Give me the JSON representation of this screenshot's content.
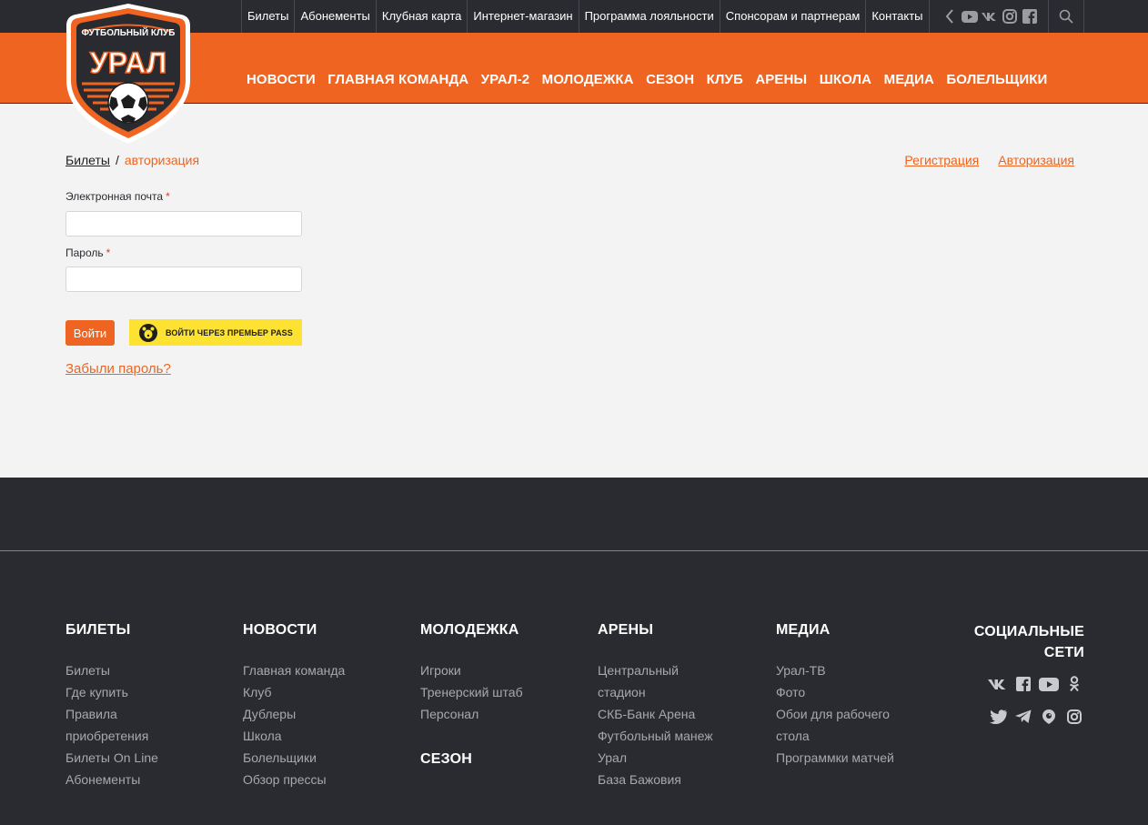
{
  "brand": {
    "logo_top_text": "ФУТБОЛЬНЫЙ КЛУБ",
    "logo_name": "УРАЛ"
  },
  "topnav": {
    "items": [
      "Билеты",
      "Абонементы",
      "Клубная карта",
      "Интернет-магазин",
      "Программа лояльности",
      "Спонсорам и партнерам",
      "Контакты"
    ],
    "icons": [
      "chevron-left-icon",
      "youtube-icon",
      "vk-icon",
      "instagram-icon",
      "facebook-icon"
    ],
    "search_icon": "search-icon"
  },
  "mainnav": {
    "items": [
      "НОВОСТИ",
      "ГЛАВНАЯ КОМАНДА",
      "УРАЛ-2",
      "МОЛОДЕЖКА",
      "СЕЗОН",
      "КЛУБ",
      "АРЕНЫ",
      "ШКОЛА",
      "МЕДИА",
      "БОЛЕЛЬЩИКИ"
    ]
  },
  "breadcrumb": {
    "link": "Билеты",
    "separator": "/",
    "current": "авторизация"
  },
  "auth_links": {
    "register": "Регистрация",
    "login": "Авторизация"
  },
  "form": {
    "email_label": "Электронная почта",
    "password_label": "Пароль",
    "required_mark": "*",
    "email_value": "",
    "password_value": "",
    "submit_label": "Войти",
    "premier_pass_label": "ВОЙТИ ЧЕРЕЗ ПРЕМЬЕР PASS",
    "forgot_label": "Забыли пароль?"
  },
  "footer": {
    "columns": [
      {
        "title": "БИЛЕТЫ",
        "links": [
          "Билеты",
          "Где купить",
          "Правила",
          "приобретения",
          "Билеты On Line",
          "Абонементы"
        ]
      },
      {
        "title": "НОВОСТИ",
        "links": [
          "Главная команда",
          "Клуб",
          "Дублеры",
          "Школа",
          "Болельщики",
          "Обзор прессы"
        ]
      },
      {
        "title": "МОЛОДЕЖКА",
        "links": [
          "Игроки",
          "Тренерский штаб",
          "Персонал"
        ],
        "extra_title": "СЕЗОН"
      },
      {
        "title": "АРЕНЫ",
        "links": [
          "Центральный",
          "стадион",
          "СКБ-Банк Арена",
          "Футбольный манеж",
          "Урал",
          "База Бажовия"
        ]
      },
      {
        "title": "МЕДИА",
        "links": [
          "Урал-ТВ",
          "Фото",
          "Обои для рабочего",
          "стола",
          "Программки матчей"
        ]
      }
    ],
    "social": {
      "title_line1": "СОЦИАЛЬНЫЕ",
      "title_line2": "СЕТИ",
      "row1": [
        "vk-icon",
        "facebook-icon",
        "youtube-icon",
        "odnoklassniki-icon"
      ],
      "row2": [
        "twitter-icon",
        "telegram-icon",
        "periscope-icon",
        "instagram-icon"
      ]
    }
  },
  "colors": {
    "accent": "#ee6420",
    "dark": "#2a2b30",
    "background": "#f3f3f3",
    "premier_yellow": "#fde232"
  }
}
